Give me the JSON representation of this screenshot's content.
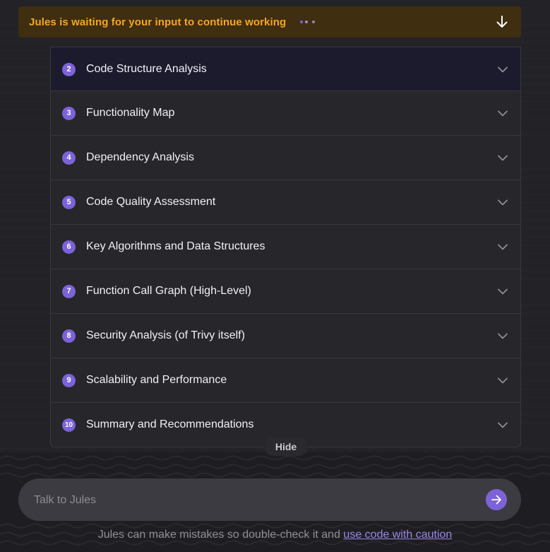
{
  "banner": {
    "text": "Jules is waiting for your input to continue working",
    "icon": "arrow-down-icon",
    "dot_colors": [
      "#7c63d8",
      "#a58be0",
      "#8f8e96"
    ]
  },
  "steps": [
    {
      "number": "2",
      "label": "Code Structure Analysis"
    },
    {
      "number": "3",
      "label": "Functionality Map"
    },
    {
      "number": "4",
      "label": "Dependency Analysis"
    },
    {
      "number": "5",
      "label": "Code Quality Assessment"
    },
    {
      "number": "6",
      "label": "Key Algorithms and Data Structures"
    },
    {
      "number": "7",
      "label": "Function Call Graph (High-Level)"
    },
    {
      "number": "8",
      "label": "Security Analysis (of Trivy itself)"
    },
    {
      "number": "9",
      "label": "Scalability and Performance"
    },
    {
      "number": "10",
      "label": "Summary and Recommendations"
    }
  ],
  "hide_label": "Hide",
  "input": {
    "placeholder": "Talk to Jules",
    "value": ""
  },
  "footer": {
    "text": "Jules can make mistakes so double-check it and ",
    "link": "use code with caution"
  },
  "colors": {
    "accent": "#7c63d8",
    "banner_bg": "#3f2e10",
    "banner_text": "#f5a623"
  }
}
